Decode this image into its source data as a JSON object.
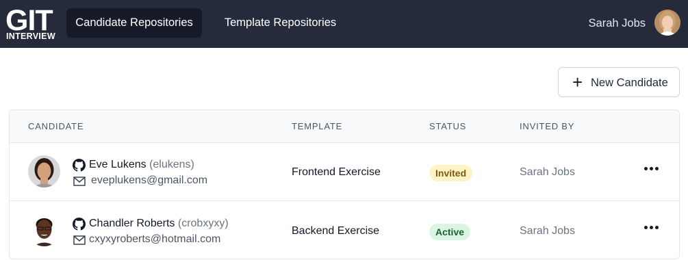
{
  "logo": {
    "main": "GIT",
    "sub": "INTERVIEW"
  },
  "nav": {
    "tabs": [
      {
        "label": "Candidate Repositories",
        "active": true
      },
      {
        "label": "Template Repositories",
        "active": false
      }
    ]
  },
  "user": {
    "name": "Sarah Jobs",
    "avatar_icon": "user-avatar"
  },
  "actions": {
    "new_candidate_label": "New Candidate",
    "new_candidate_icon": "plus-icon"
  },
  "table": {
    "headers": {
      "candidate": "CANDIDATE",
      "template": "TEMPLATE",
      "status": "STATUS",
      "invited_by": "INVITED BY"
    },
    "rows": [
      {
        "name": "Eve Lukens",
        "handle": "(elukens)",
        "email": "eveplukens@gmail.com",
        "template": "Frontend Exercise",
        "status": "Invited",
        "invited_by": "Sarah Jobs"
      },
      {
        "name": "Chandler Roberts",
        "handle": "(crobxyxy)",
        "email": "cxyxyroberts@hotmail.com",
        "template": "Backend Exercise",
        "status": "Active",
        "invited_by": "Sarah Jobs"
      }
    ]
  },
  "colors": {
    "topbar": "#252b3b",
    "active_tab": "#161b27",
    "badge_invited_bg": "#fdf3c4",
    "badge_active_bg": "#daf5e4"
  }
}
